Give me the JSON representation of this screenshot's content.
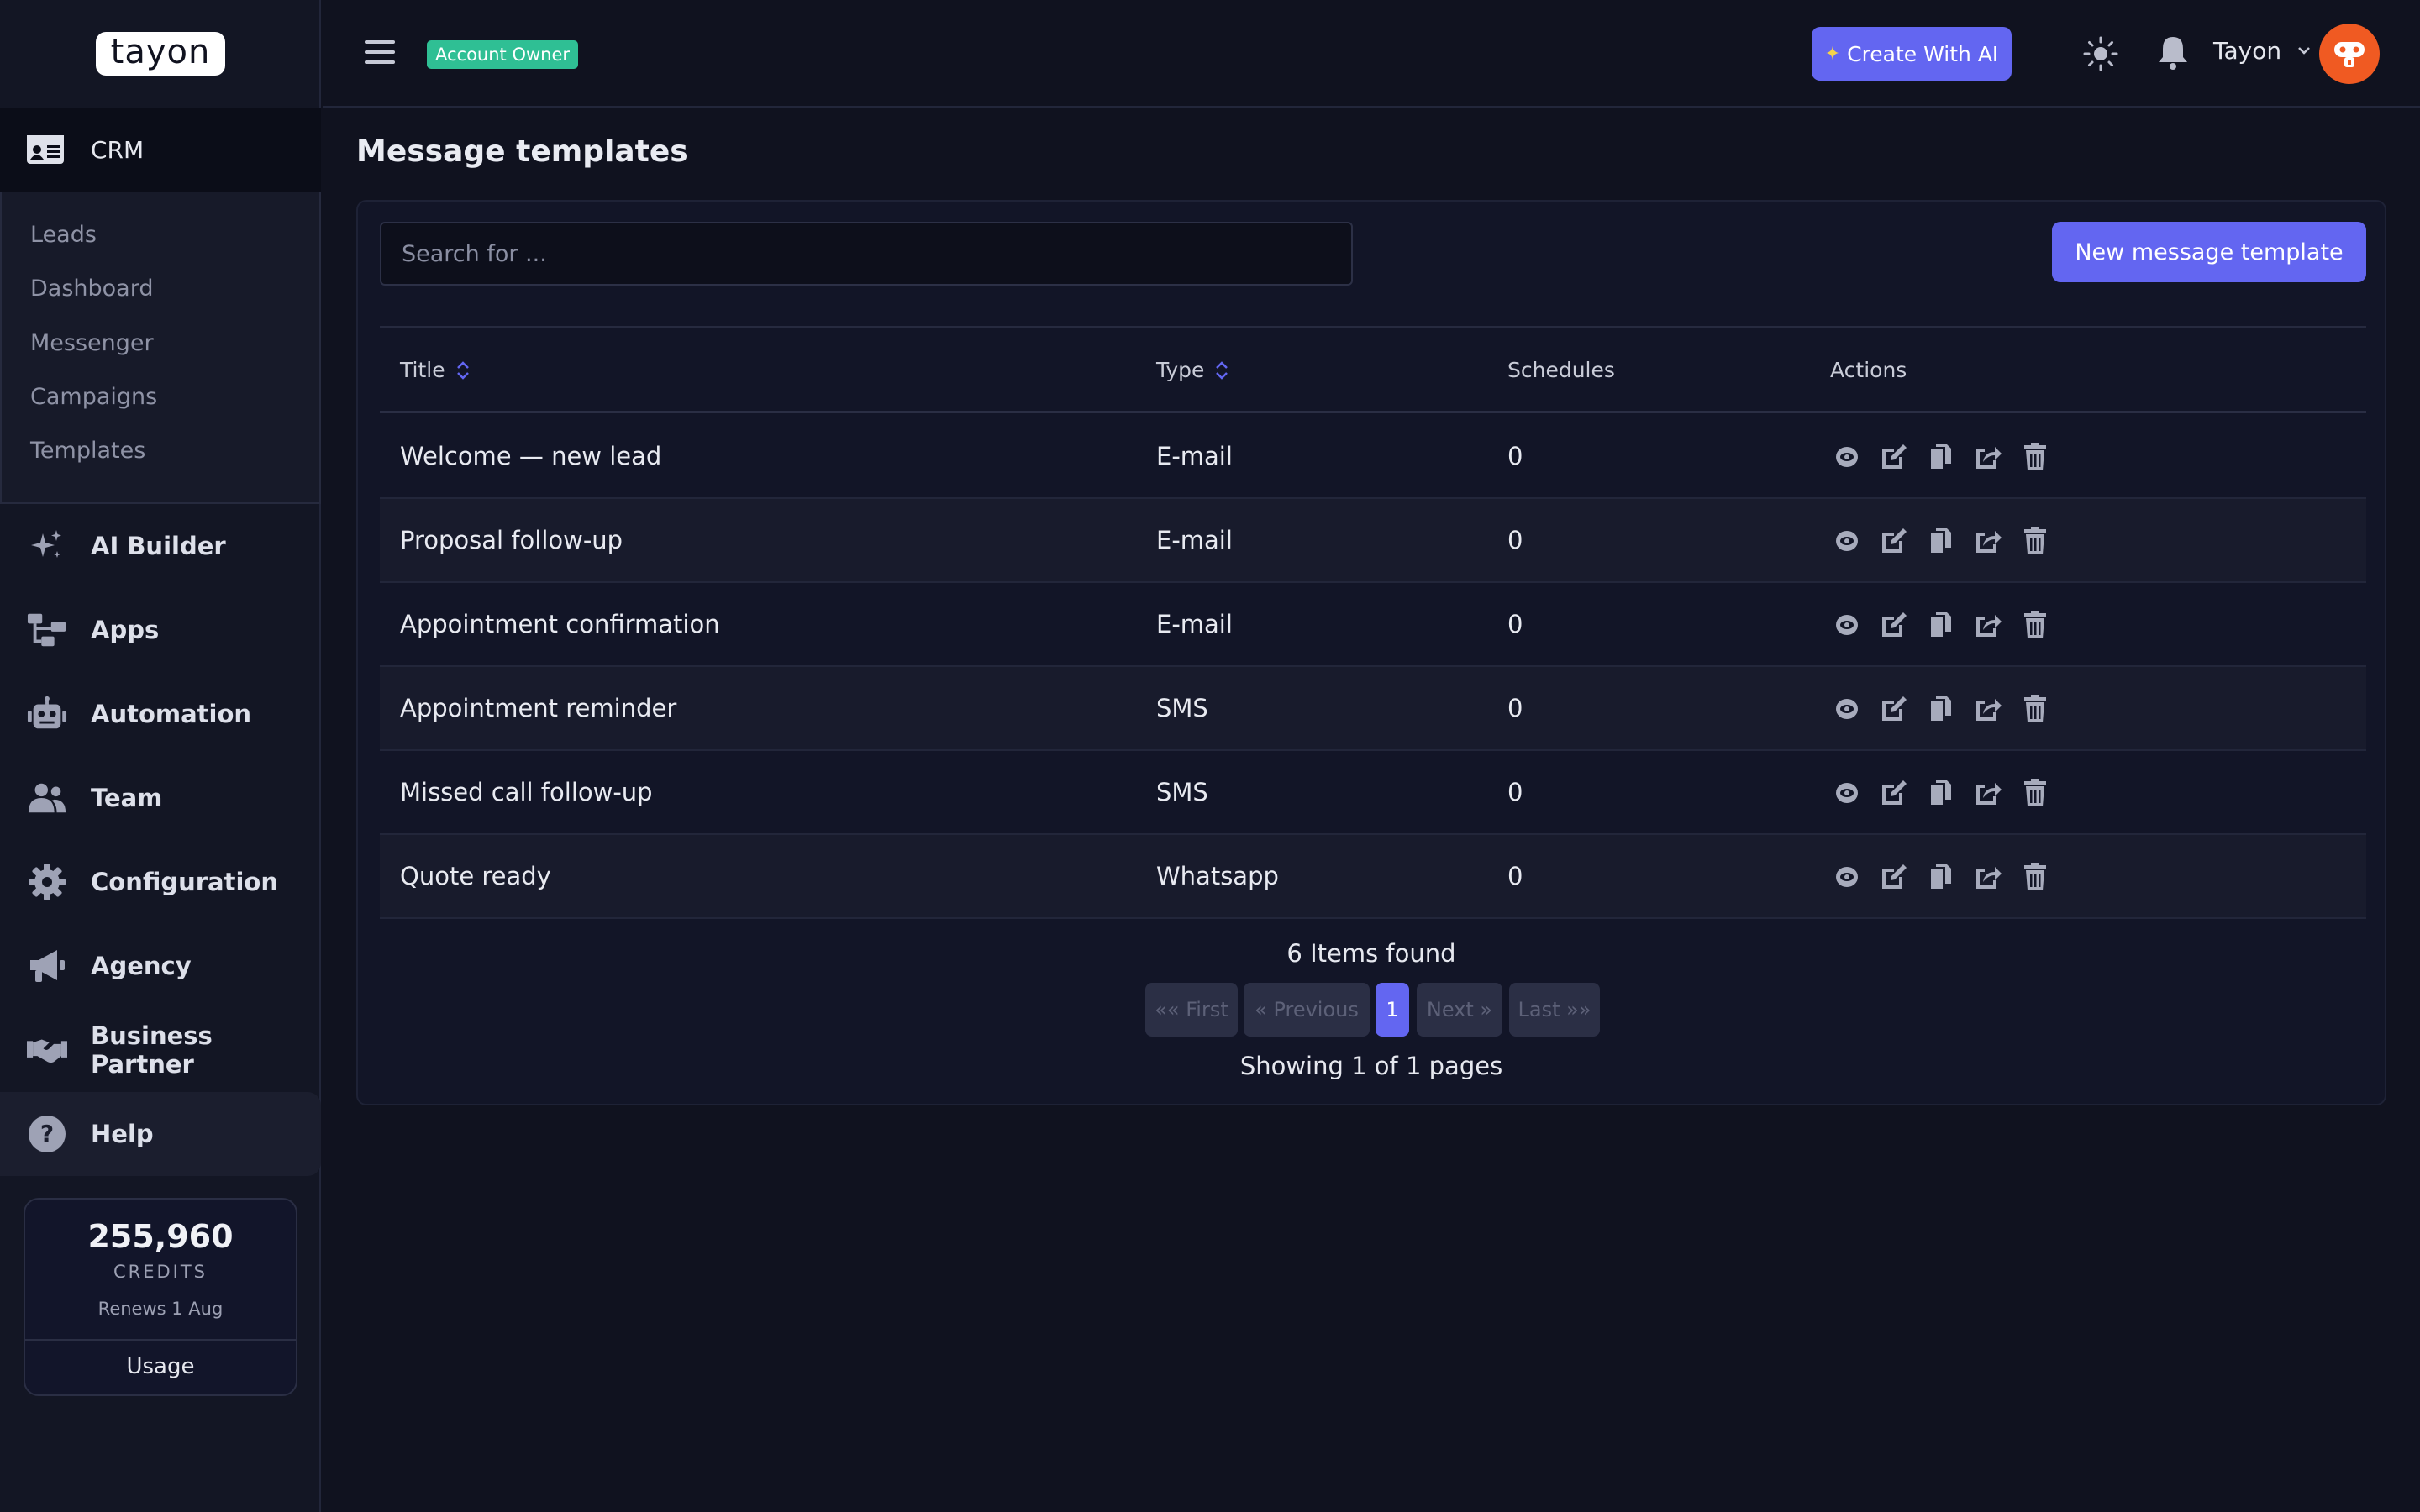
{
  "brand": {
    "logo_text": "tayon"
  },
  "sidebar": {
    "crm_label": "CRM",
    "crm_items": [
      "Leads",
      "Dashboard",
      "Messenger",
      "Campaigns",
      "Templates"
    ],
    "nav": [
      {
        "label": "AI Builder",
        "icon": "sparkles-icon"
      },
      {
        "label": "Apps",
        "icon": "sitemap-icon"
      },
      {
        "label": "Automation",
        "icon": "robot-icon"
      },
      {
        "label": "Team",
        "icon": "users-icon"
      },
      {
        "label": "Configuration",
        "icon": "gear-icon"
      },
      {
        "label": "Agency",
        "icon": "megaphone-icon"
      },
      {
        "label": "Business Partner",
        "icon": "handshake-icon"
      },
      {
        "label": "Help",
        "icon": "question-circle-icon"
      }
    ],
    "credits": {
      "amount": "255,960",
      "unit": "CREDITS",
      "renews": "Renews 1 Aug",
      "usage_label": "Usage"
    }
  },
  "topbar": {
    "badge": "Account Owner",
    "create_ai_label": "Create With AI",
    "user_name": "Tayon"
  },
  "main": {
    "title": "Message templates",
    "search_placeholder": "Search for ...",
    "new_button": "New message template",
    "columns": {
      "title": "Title",
      "type": "Type",
      "schedules": "Schedules",
      "actions": "Actions"
    },
    "rows": [
      {
        "title": "Welcome — new lead",
        "type": "E-mail",
        "schedules": "0"
      },
      {
        "title": "Proposal follow-up",
        "type": "E-mail",
        "schedules": "0"
      },
      {
        "title": "Appointment confirmation",
        "type": "E-mail",
        "schedules": "0"
      },
      {
        "title": "Appointment reminder",
        "type": "SMS",
        "schedules": "0"
      },
      {
        "title": "Missed call follow-up",
        "type": "SMS",
        "schedules": "0"
      },
      {
        "title": "Quote ready",
        "type": "Whatsapp",
        "schedules": "0"
      }
    ],
    "items_found": "6 Items found",
    "pagination": {
      "first": "«« First",
      "previous": "« Previous",
      "current": "1",
      "next": "Next »",
      "last": "Last »»"
    },
    "showing": "Showing 1 of 1 pages"
  },
  "colors": {
    "accent": "#6366f1",
    "badge": "#2fbf94",
    "avatar": "#f05a22",
    "background": "#10121f"
  }
}
